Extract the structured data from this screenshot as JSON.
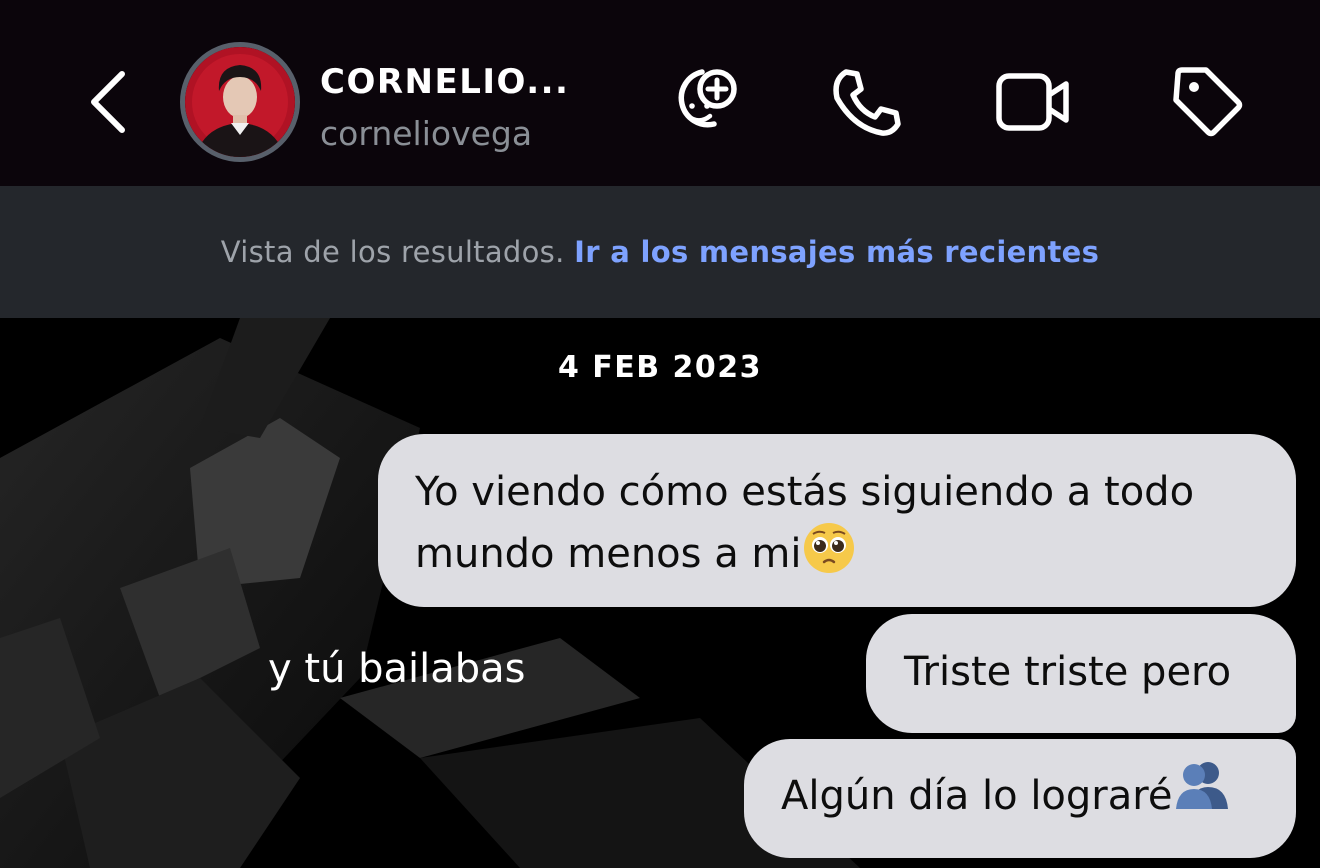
{
  "header": {
    "contact_name": "CORNELIO...",
    "contact_handle": "corneliovega",
    "icons": [
      "back-chevron-icon",
      "add-friend-icon",
      "phone-icon",
      "video-camera-icon",
      "tag-icon"
    ]
  },
  "banner": {
    "prefix": "Vista de los resultados.",
    "link": "Ir a los mensajes más recientes"
  },
  "chat": {
    "date": "4 FEB 2023",
    "messages": [
      {
        "direction": "outgoing",
        "text": "Yo viendo cómo estás siguiendo a todo mundo menos a mi",
        "emoji": "pleading-face"
      },
      {
        "direction": "incoming",
        "text": "y tú bailabas"
      },
      {
        "direction": "outgoing",
        "text": "Triste triste pero"
      },
      {
        "direction": "outgoing",
        "text": "Algún día lo lograré",
        "emoji": "busts-in-silhouette"
      }
    ]
  },
  "colors": {
    "header_bg": "#0b050b",
    "banner_bg": "#24272c",
    "banner_link": "#7ea2ff",
    "bubble_bg": "#dddde2"
  }
}
